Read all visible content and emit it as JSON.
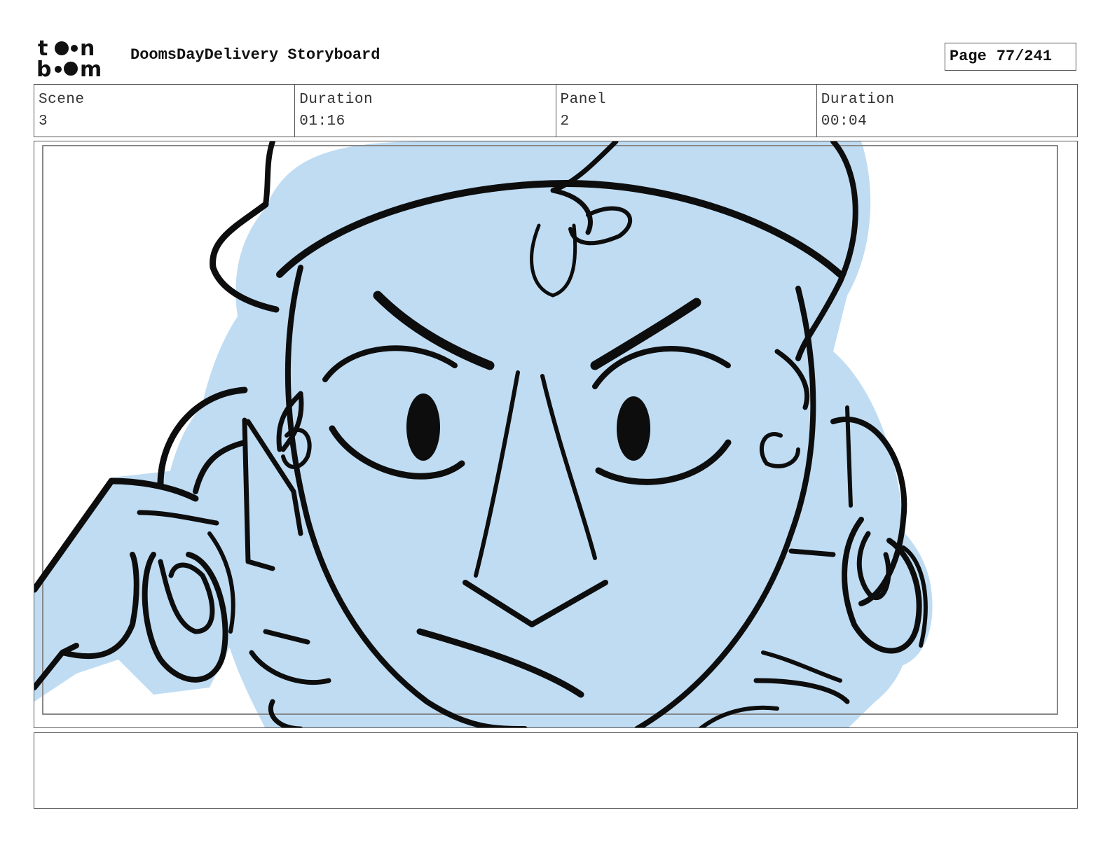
{
  "header": {
    "title": "DoomsDayDelivery Storyboard",
    "page_label": "Page",
    "page_value": "77/241"
  },
  "info": {
    "scene_label": "Scene",
    "scene_value": "3",
    "scene_duration_label": "Duration",
    "scene_duration_value": "01:16",
    "panel_label": "Panel",
    "panel_value": "2",
    "panel_duration_label": "Duration",
    "panel_duration_value": "00:04"
  },
  "notes": {
    "text": ""
  },
  "colors": {
    "fill": "#bfdcf3",
    "ink": "#0d0d0d",
    "border": "#555555"
  }
}
